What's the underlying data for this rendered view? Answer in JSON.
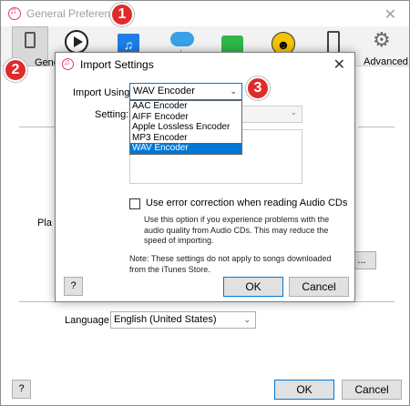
{
  "outer": {
    "title": "General Preferences",
    "toolbar": {
      "general_label": "General",
      "advanced_label": "Advanced"
    },
    "playback_fragment": "Pla",
    "button_fragment": "...",
    "language_label": "Language:",
    "language_value": "English (United States)",
    "help_label": "?",
    "ok_label": "OK",
    "cancel_label": "Cancel"
  },
  "dialog": {
    "title": "Import Settings",
    "import_using_label": "Import Using:",
    "import_using_value": "WAV Encoder",
    "setting_label": "Setting:",
    "encoder_options": [
      "AAC Encoder",
      "AIFF Encoder",
      "Apple Lossless Encoder",
      "MP3 Encoder",
      "WAV Encoder"
    ],
    "selected_option": "WAV Encoder",
    "error_correction_label": "Use error correction when reading Audio CDs",
    "error_correction_hint": "Use this option if you experience problems with the audio quality from Audio CDs.  This may reduce the speed of importing.",
    "note": "Note: These settings do not apply to songs downloaded from the iTunes Store.",
    "help_label": "?",
    "ok_label": "OK",
    "cancel_label": "Cancel"
  },
  "annotations": {
    "step1": "1",
    "step2": "2",
    "step3": "3"
  },
  "colors": {
    "accent": "#0078d7",
    "badge": "#e02b2b"
  },
  "icons": [
    "itunes-icon",
    "general-icon",
    "playback-icon",
    "music-icon",
    "cloud-download-icon",
    "store-lock-icon",
    "parental-icon",
    "device-icon",
    "gear-icon",
    "close-icon",
    "chevron-down-icon"
  ]
}
